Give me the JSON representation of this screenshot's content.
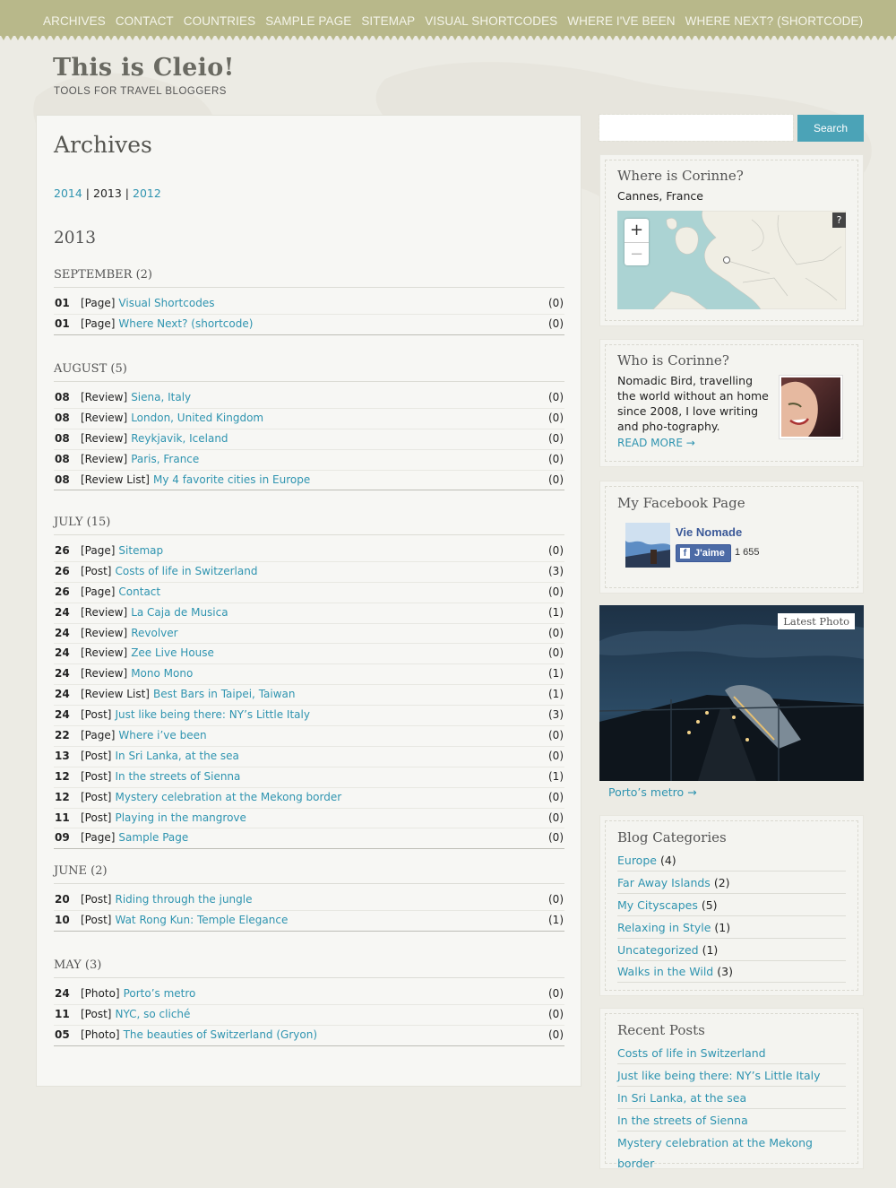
{
  "nav": {
    "items": [
      "ARCHIVES",
      "CONTACT",
      "COUNTRIES",
      "SAMPLE PAGE",
      "SITEMAP",
      "VISUAL SHORTCODES",
      "WHERE I'VE BEEN",
      "WHERE NEXT? (SHORTCODE)"
    ]
  },
  "site": {
    "title": "This is Cleio!",
    "tagline": "TOOLS FOR TRAVEL BLOGGERS"
  },
  "archive": {
    "title": "Archives",
    "years": [
      "2014",
      "2013",
      "2012"
    ],
    "separator": "|",
    "current_year": "2013",
    "months": [
      {
        "name": "SEPTEMBER (2)",
        "entries": [
          {
            "day": "01",
            "kind": "[Page]",
            "title": "Visual Shortcodes",
            "count": "(0)"
          },
          {
            "day": "01",
            "kind": "[Page]",
            "title": "Where Next? (shortcode)",
            "count": "(0)"
          }
        ]
      },
      {
        "name": "AUGUST (5)",
        "entries": [
          {
            "day": "08",
            "kind": "[Review]",
            "title": "Siena, Italy",
            "count": "(0)"
          },
          {
            "day": "08",
            "kind": "[Review]",
            "title": "London, United Kingdom",
            "count": "(0)"
          },
          {
            "day": "08",
            "kind": "[Review]",
            "title": "Reykjavik, Iceland",
            "count": "(0)"
          },
          {
            "day": "08",
            "kind": "[Review]",
            "title": "Paris, France",
            "count": "(0)"
          },
          {
            "day": "08",
            "kind": "[Review List]",
            "title": "My 4 favorite cities in Europe",
            "count": "(0)"
          }
        ]
      },
      {
        "name": "JULY (15)",
        "entries": [
          {
            "day": "26",
            "kind": "[Page]",
            "title": "Sitemap",
            "count": "(0)"
          },
          {
            "day": "26",
            "kind": "[Post]",
            "title": "Costs of life in Switzerland",
            "count": "(3)"
          },
          {
            "day": "26",
            "kind": "[Page]",
            "title": "Contact",
            "count": "(0)"
          },
          {
            "day": "24",
            "kind": "[Review]",
            "title": "La Caja de Musica",
            "count": "(1)"
          },
          {
            "day": "24",
            "kind": "[Review]",
            "title": "Revolver",
            "count": "(0)"
          },
          {
            "day": "24",
            "kind": "[Review]",
            "title": "Zee Live House",
            "count": "(0)"
          },
          {
            "day": "24",
            "kind": "[Review]",
            "title": "Mono Mono",
            "count": "(1)"
          },
          {
            "day": "24",
            "kind": "[Review List]",
            "title": "Best Bars in Taipei, Taiwan",
            "count": "(1)"
          },
          {
            "day": "24",
            "kind": "[Post]",
            "title": "Just like being there: NY’s Little Italy",
            "count": "(3)"
          },
          {
            "day": "22",
            "kind": "[Page]",
            "title": "Where i’ve been",
            "count": "(0)"
          },
          {
            "day": "13",
            "kind": "[Post]",
            "title": "In Sri Lanka, at the sea",
            "count": "(0)"
          },
          {
            "day": "12",
            "kind": "[Post]",
            "title": "In the streets of Sienna",
            "count": "(1)"
          },
          {
            "day": "12",
            "kind": "[Post]",
            "title": "Mystery celebration at the Mekong border",
            "count": "(0)"
          },
          {
            "day": "11",
            "kind": "[Post]",
            "title": "Playing in the mangrove",
            "count": "(0)"
          },
          {
            "day": "09",
            "kind": "[Page]",
            "title": "Sample Page",
            "count": "(0)"
          }
        ]
      },
      {
        "name": "JUNE (2)",
        "entries": [
          {
            "day": "20",
            "kind": "[Post]",
            "title": "Riding through the jungle",
            "count": "(0)"
          },
          {
            "day": "10",
            "kind": "[Post]",
            "title": "Wat Rong Kun: Temple Elegance",
            "count": "(1)"
          }
        ]
      },
      {
        "name": "MAY (3)",
        "entries": [
          {
            "day": "24",
            "kind": "[Photo]",
            "title": "Porto’s metro",
            "count": "(0)"
          },
          {
            "day": "11",
            "kind": "[Post]",
            "title": "NYC, so cliché",
            "count": "(0)"
          },
          {
            "day": "05",
            "kind": "[Photo]",
            "title": "The beauties of Switzerland (Gryon)",
            "count": "(0)"
          }
        ]
      }
    ]
  },
  "search": {
    "button_label": "Search",
    "placeholder": ""
  },
  "where": {
    "title": "Where is Corinne?",
    "location": "Cannes, France",
    "zoom_in": "+",
    "zoom_out": "−",
    "help": "?"
  },
  "who": {
    "title": "Who is Corinne?",
    "bio": "Nomadic Bird, travelling the world without an home since 2008, I love writing and pho-tography.",
    "read_more": "READ MORE →"
  },
  "facebook": {
    "title": "My Facebook Page",
    "page_name": "Vie Nomade",
    "like_label": "J'aime",
    "like_count": "1 655"
  },
  "latest_photo": {
    "label": "Latest Photo",
    "caption": "Porto’s metro →"
  },
  "categories": {
    "title": "Blog Categories",
    "items": [
      {
        "name": "Europe",
        "count": "(4)"
      },
      {
        "name": "Far Away Islands",
        "count": "(2)"
      },
      {
        "name": "My Cityscapes",
        "count": "(5)"
      },
      {
        "name": "Relaxing in Style",
        "count": "(1)"
      },
      {
        "name": "Uncategorized",
        "count": "(1)"
      },
      {
        "name": "Walks in the Wild",
        "count": "(3)"
      }
    ]
  },
  "recent": {
    "title": "Recent Posts",
    "items": [
      "Costs of life in Switzerland",
      "Just like being there: NY’s Little Italy",
      "In Sri Lanka, at the sea",
      "In the streets of Sienna",
      "Mystery celebration at the Mekong border"
    ]
  },
  "colors": {
    "nav_bg": "#b8b88a",
    "link": "#2f94b0",
    "search_button": "#4ba3b7",
    "page_bg": "#ecebe4"
  }
}
